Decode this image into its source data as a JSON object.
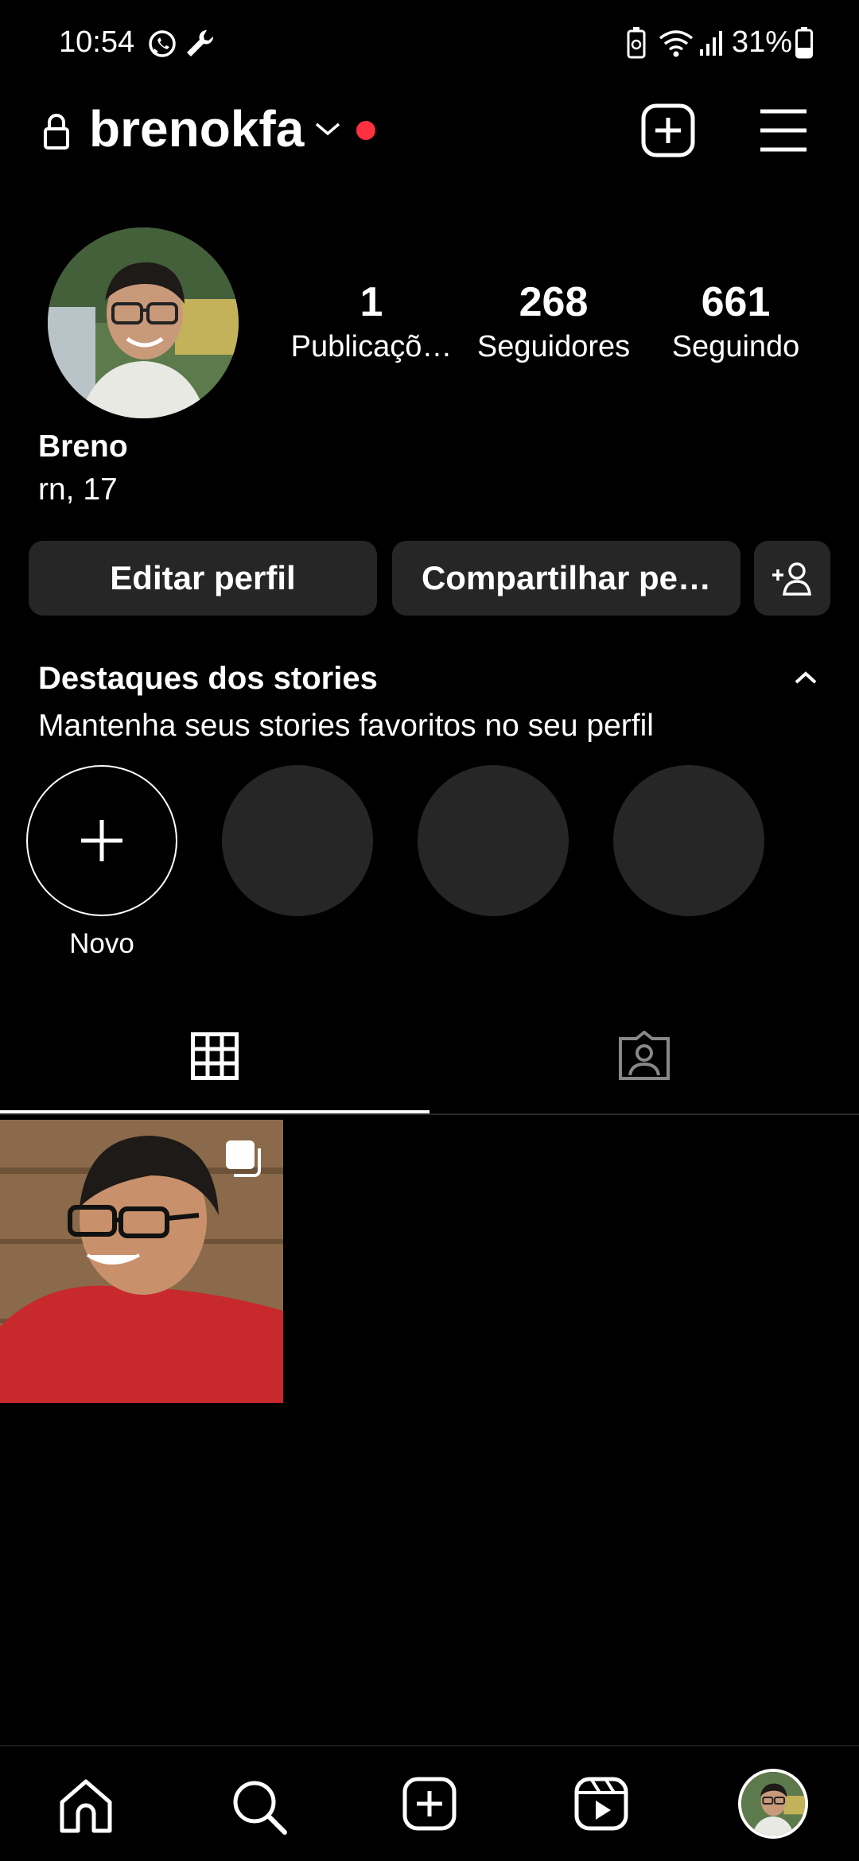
{
  "status_bar": {
    "time": "10:54",
    "battery": "31%"
  },
  "header": {
    "username": "brenokfa"
  },
  "profile": {
    "stats": [
      {
        "value": "1",
        "label": "Publicaçõ…"
      },
      {
        "value": "268",
        "label": "Seguidores"
      },
      {
        "value": "661",
        "label": "Seguindo"
      }
    ],
    "name": "Breno",
    "bio": "rn, 17"
  },
  "buttons": {
    "edit_profile": "Editar perfil",
    "share_profile": "Compartilhar pe…"
  },
  "highlights": {
    "title": "Destaques dos stories",
    "subtitle": "Mantenha seus stories favoritos no seu perfil",
    "new_label": "Novo"
  },
  "colors": {
    "background": "#000000",
    "button_bg": "#262626",
    "notification_dot": "#ff3040"
  },
  "icons": {
    "status": [
      "whatsapp-icon",
      "wrench-icon",
      "recycle-battery-icon",
      "wifi-icon",
      "signal-icon",
      "battery-icon"
    ],
    "header": [
      "lock-icon",
      "chevron-down-icon",
      "new-post-icon",
      "menu-icon"
    ],
    "tabs": [
      "grid-icon",
      "tagged-icon"
    ],
    "nav": [
      "home-icon",
      "search-icon",
      "create-icon",
      "reels-icon",
      "profile-avatar"
    ]
  }
}
